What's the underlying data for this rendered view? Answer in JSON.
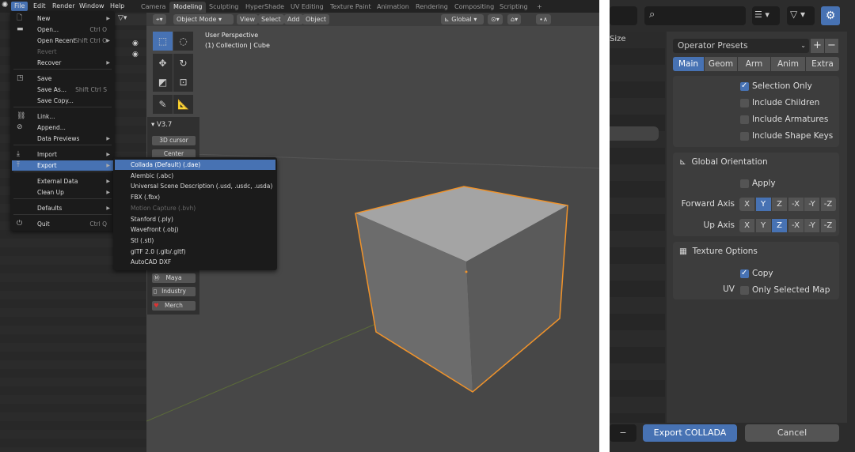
{
  "topbar": {
    "menus": [
      "File",
      "Edit",
      "Render",
      "Window",
      "Help"
    ],
    "workspaces": [
      "Camera",
      "Modeling",
      "Sculpting",
      "HyperShade",
      "UV Editing",
      "Texture Paint",
      "Animation",
      "Rendering",
      "Compositing",
      "Scripting",
      "+"
    ],
    "active_workspace": "Modeling"
  },
  "viewport_header": {
    "mode": "Object Mode",
    "menus": [
      "View",
      "Select",
      "Add",
      "Object"
    ],
    "orientation": "Global"
  },
  "viewport": {
    "perspective": "User Perspective",
    "collection": "(1) Collection | Cube"
  },
  "file_menu": [
    {
      "label": "New",
      "icon": "file-new-icon",
      "arrow": true
    },
    {
      "label": "Open...",
      "icon": "folder-icon",
      "shortcut": "Ctrl O"
    },
    {
      "label": "Open Recent",
      "shortcut": "Shift Ctrl O",
      "arrow": true
    },
    {
      "label": "Revert",
      "disabled": true
    },
    {
      "label": "Recover",
      "arrow": true
    },
    {
      "label": "Save",
      "icon": "save-icon"
    },
    {
      "label": "Save As...",
      "shortcut": "Shift Ctrl S"
    },
    {
      "label": "Save Copy..."
    },
    {
      "label": "Link...",
      "icon": "link-icon"
    },
    {
      "label": "Append...",
      "icon": "append-icon"
    },
    {
      "label": "Data Previews",
      "arrow": true
    },
    {
      "label": "Import",
      "icon": "import-icon",
      "arrow": true
    },
    {
      "label": "Export",
      "icon": "export-icon",
      "arrow": true,
      "highlighted": true
    },
    {
      "label": "External Data",
      "arrow": true
    },
    {
      "label": "Clean Up",
      "arrow": true
    },
    {
      "label": "Defaults",
      "arrow": true
    },
    {
      "label": "Quit",
      "icon": "power-icon",
      "shortcut": "Ctrl Q"
    }
  ],
  "export_menu": [
    {
      "label": "Collada (Default) (.dae)",
      "highlighted": true
    },
    {
      "label": "Alembic (.abc)"
    },
    {
      "label": "Universal Scene Description (.usd, .usdc, .usda)"
    },
    {
      "label": "FBX (.fbx)"
    },
    {
      "label": "Motion Capture (.bvh)",
      "disabled": true
    },
    {
      "label": "Stanford (.ply)"
    },
    {
      "label": "Wavefront (.obj)"
    },
    {
      "label": "Stl (.stl)"
    },
    {
      "label": "glTF 2.0 (.glb/.gltf)"
    },
    {
      "label": "AutoCAD DXF"
    }
  ],
  "npanel": {
    "title": "V3.7",
    "buttons": [
      "3D cursor",
      "Center"
    ],
    "bottom_buttons": [
      "Maya",
      "Industry",
      "Merch"
    ]
  },
  "export_dialog": {
    "column_header": "Size",
    "presets": "Operator Presets",
    "tabs": [
      "Main",
      "Geom",
      "Arm",
      "Anim",
      "Extra"
    ],
    "active_tab": "Main",
    "main_options": [
      {
        "label": "Selection Only",
        "checked": true
      },
      {
        "label": "Include Children",
        "checked": false
      },
      {
        "label": "Include Armatures",
        "checked": false
      },
      {
        "label": "Include Shape Keys",
        "checked": false
      }
    ],
    "orientation": {
      "title": "Global Orientation",
      "apply": {
        "label": "Apply",
        "checked": false
      },
      "forward_label": "Forward Axis",
      "forward": "Y",
      "up_label": "Up Axis",
      "up": "Z",
      "axes": [
        "X",
        "Y",
        "Z",
        "-X",
        "-Y",
        "-Z"
      ]
    },
    "texture": {
      "title": "Texture Options",
      "copy": {
        "label": "Copy",
        "checked": true
      },
      "uv_label": "UV",
      "only_selected": {
        "label": "Only Selected Map",
        "checked": false
      }
    },
    "export_button": "Export COLLADA",
    "cancel_button": "Cancel"
  },
  "colors": {
    "accent": "#4772b3",
    "selection_outline": "#f0932b"
  }
}
